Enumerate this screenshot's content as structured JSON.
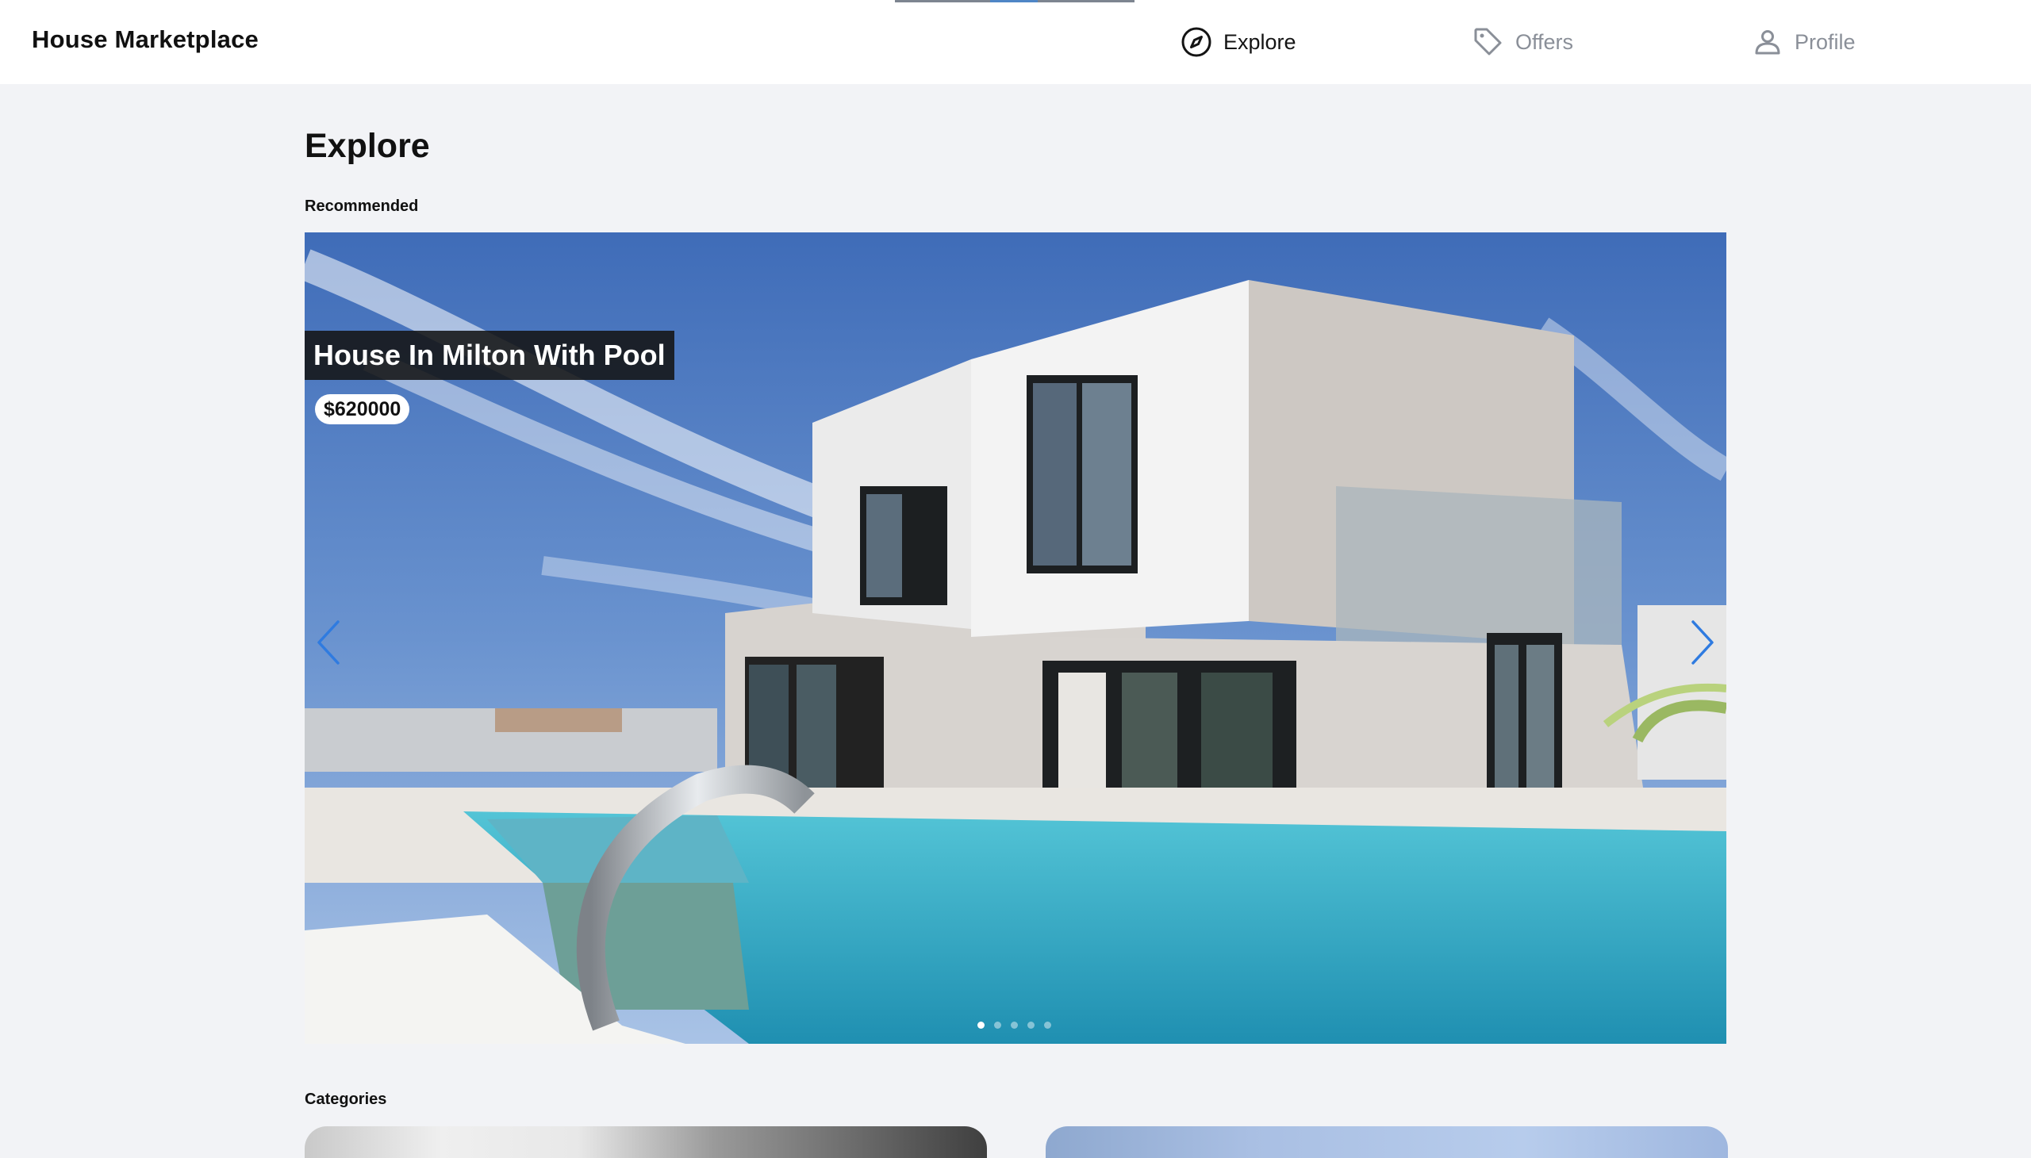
{
  "header": {
    "brand": "House Marketplace",
    "nav": [
      {
        "label": "Explore",
        "icon": "compass-icon",
        "active": true
      },
      {
        "label": "Offers",
        "icon": "tag-icon",
        "active": false
      },
      {
        "label": "Profile",
        "icon": "user-icon",
        "active": false
      }
    ]
  },
  "main": {
    "title": "Explore",
    "recommended_label": "Recommended",
    "categories_label": "Categories"
  },
  "slider": {
    "slide_title": "House In Milton With Pool",
    "slide_price": "$620000",
    "slide_count": 5,
    "active_slide": 1
  },
  "colors": {
    "page_bg": "#f2f3f6",
    "nav_active": "#141414",
    "nav_inactive": "#8a8f98",
    "arrow": "#2f7be0"
  }
}
